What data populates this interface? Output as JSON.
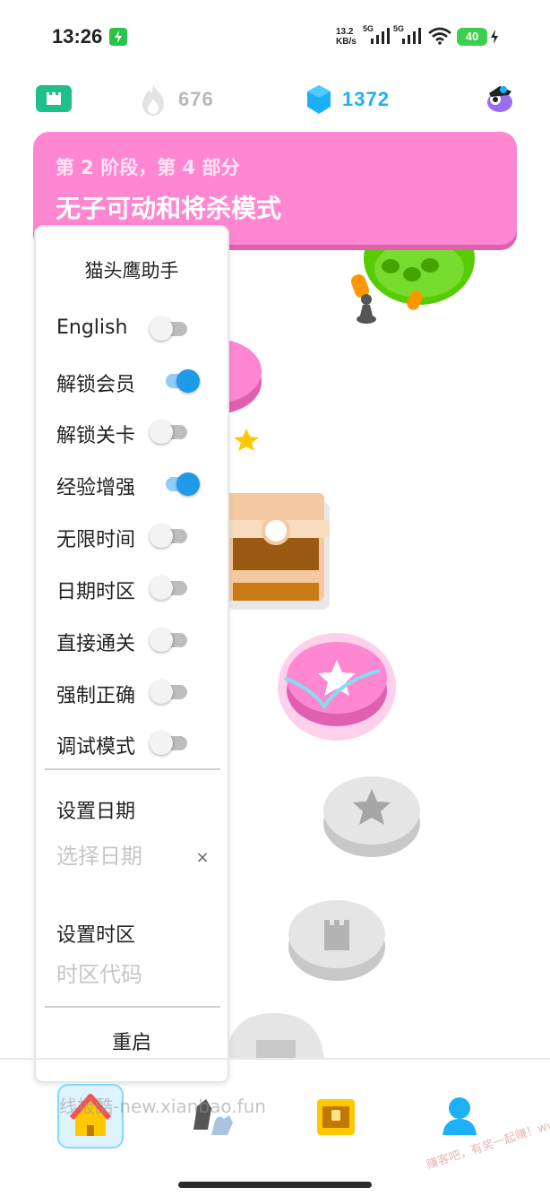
{
  "status_bar": {
    "time": "13:26",
    "net_speed_value": "13.2",
    "net_speed_unit": "KB/s",
    "signal1_label": "5G",
    "signal2_label": "5G",
    "battery": "40"
  },
  "top_bar": {
    "streak_count": "676",
    "gems_count": "1372"
  },
  "unit": {
    "subtitle": "第 2 阶段，第 4 部分",
    "title": "无子可动和将杀模式"
  },
  "helper_panel": {
    "title": "猫头鹰助手",
    "options": [
      {
        "label": "English",
        "on": false
      },
      {
        "label": "解锁会员",
        "on": true
      },
      {
        "label": "解锁关卡",
        "on": false
      },
      {
        "label": "经验增强",
        "on": true
      },
      {
        "label": "无限时间",
        "on": false
      },
      {
        "label": "日期时区",
        "on": false
      },
      {
        "label": "直接通关",
        "on": false
      },
      {
        "label": "强制正确",
        "on": false
      },
      {
        "label": "调试模式",
        "on": false
      }
    ],
    "date_label": "设置日期",
    "date_placeholder": "选择日期",
    "clear_symbol": "×",
    "timezone_label": "设置时区",
    "timezone_placeholder": "时区代码",
    "restart_label": "重启"
  },
  "watermarks": {
    "main": "线报酷-new.xianbao.fun",
    "corner": "赚客吧，有奖一起赚！www.zuanke8.com"
  },
  "colors": {
    "banner": "#ff86d0",
    "accent_blue": "#1cb0f6",
    "switch_on": "#1e9be8"
  },
  "icons": {
    "course": "castle-icon",
    "streak": "flame-icon",
    "gems": "gem-icon",
    "profile": "avatar-icon",
    "nav": [
      "home-icon",
      "chess-pieces-icon",
      "treasure-chest-icon",
      "profile-icon"
    ]
  }
}
